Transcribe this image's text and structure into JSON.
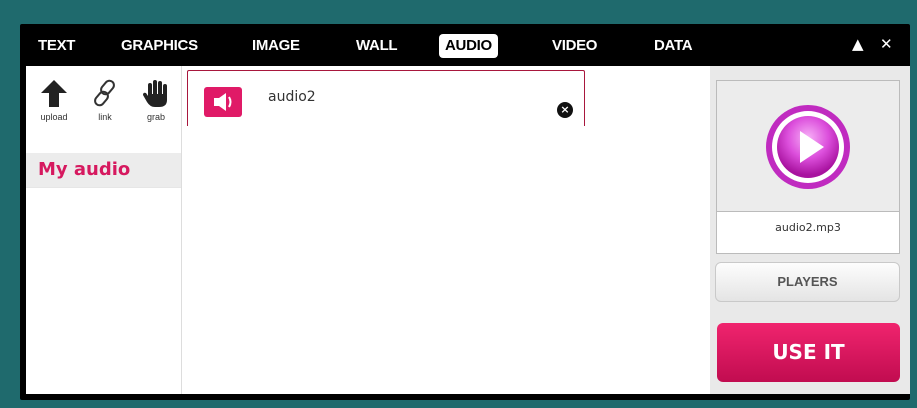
{
  "tabs": [
    {
      "label": "TEXT"
    },
    {
      "label": "GRAPHICS"
    },
    {
      "label": "IMAGE"
    },
    {
      "label": "WALL"
    },
    {
      "label": "AUDIO",
      "active": true
    },
    {
      "label": "VIDEO"
    },
    {
      "label": "DATA"
    }
  ],
  "window_controls": {
    "collapse": "▲",
    "close": "✕"
  },
  "sidebar": {
    "tools": [
      {
        "label": "upload",
        "icon": "upload-arrow-icon"
      },
      {
        "label": "link",
        "icon": "link-chain-icon"
      },
      {
        "label": "grab",
        "icon": "grab-hand-icon"
      }
    ],
    "section_label": "My audio"
  },
  "items": [
    {
      "label": "audio2",
      "icon": "speaker-icon",
      "remove_icon": "close-circle-icon"
    }
  ],
  "preview": {
    "filename": "audio2.mp3",
    "icon": "play-button-icon"
  },
  "buttons": {
    "players": "PLAYERS",
    "use_it": "USE IT"
  },
  "colors": {
    "accent": "#e01a67",
    "play": "#d94fd9",
    "background": "#1f6a6d"
  }
}
